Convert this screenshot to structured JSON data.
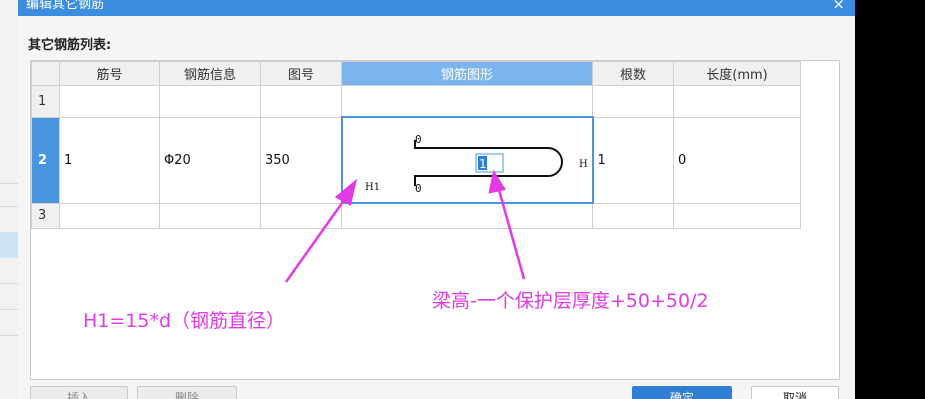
{
  "dialog": {
    "title": "编辑其它钢筋",
    "close_icon": "×",
    "list_label": "其它钢筋列表:"
  },
  "table": {
    "columns": [
      "",
      "筋号",
      "钢筋信息",
      "图号",
      "钢筋图形",
      "根数",
      "长度(mm)"
    ],
    "rows": [
      {
        "index": "1",
        "bar_no": "",
        "info": "",
        "figure_no": "",
        "count": "",
        "length": ""
      },
      {
        "index": "2",
        "bar_no": "1",
        "info": "Φ20",
        "figure_no": "350",
        "count": "1",
        "length": "0"
      },
      {
        "index": "3",
        "bar_no": "",
        "info": "",
        "figure_no": "",
        "count": "",
        "length": ""
      }
    ]
  },
  "shape": {
    "left_label": "H1",
    "right_label": "H",
    "top_value": "0",
    "bottom_value": "0",
    "input_value": "1"
  },
  "buttons": {
    "insert": "插入",
    "delete": "删除",
    "ok": "确定",
    "cancel": "取消"
  },
  "annotations": {
    "h1_note": "H1=15*d（钢筋直径）",
    "height_note": "梁高-一个保护层厚度+50+50/2",
    "color": "#e23be6"
  }
}
